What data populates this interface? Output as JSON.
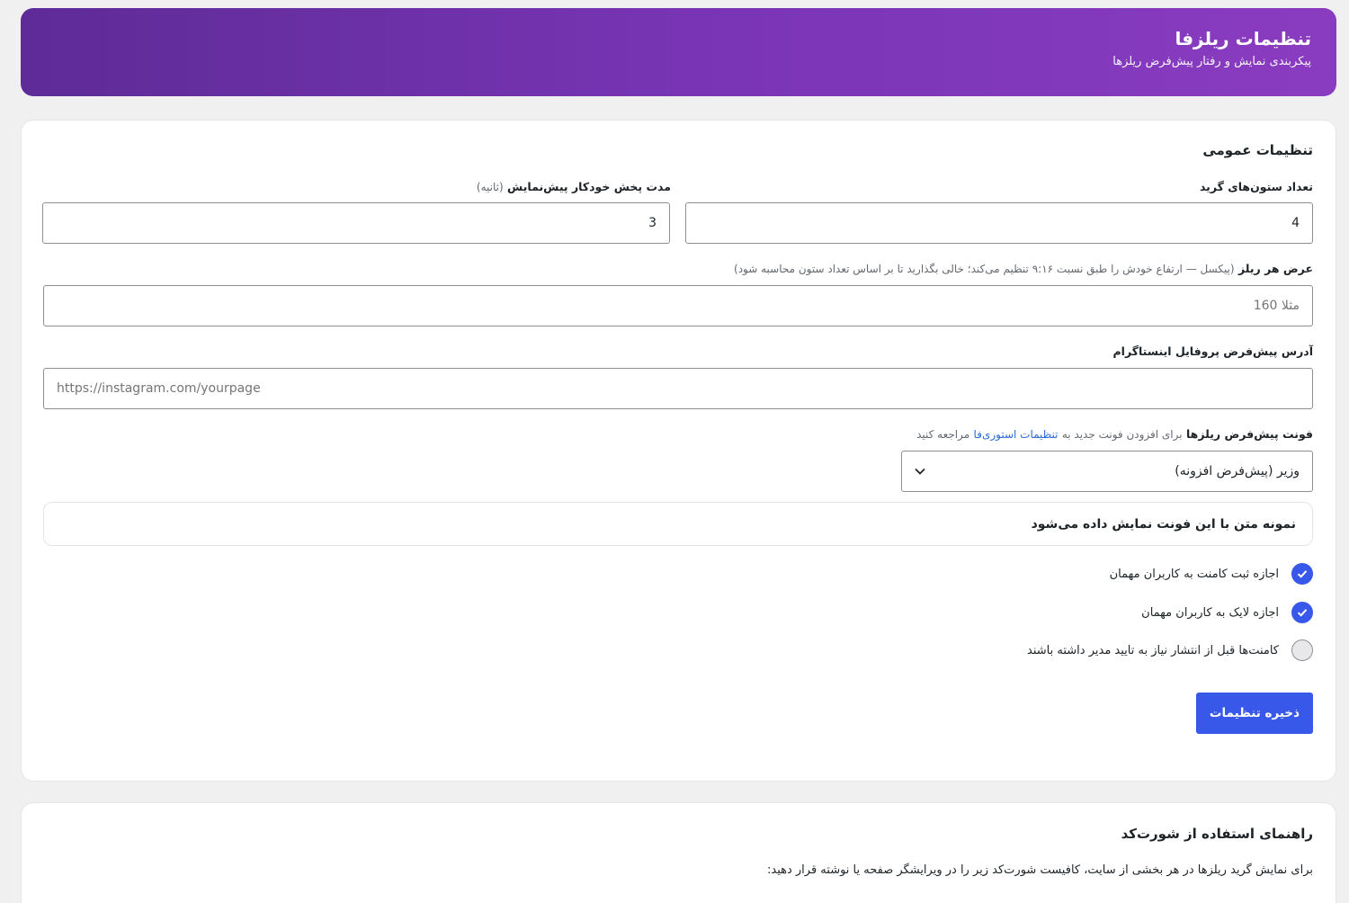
{
  "header": {
    "title": "تنظیمات ریلزفا",
    "subtitle": "پیکربندی نمایش و رفتار پیش‌فرض ریلزها"
  },
  "general": {
    "section_title": "تنظیمات عمومی",
    "grid_columns": {
      "label": "تعداد ستون‌های گرید",
      "value": "4"
    },
    "autoplay": {
      "label": "مدت پخش خودکار پیش‌نمایش",
      "hint": "(ثانیه)",
      "value": "3"
    },
    "reel_width": {
      "label": "عرض هر ریلز",
      "hint": "(پیکسل — ارتفاع خودش را طبق نسبت ۹:۱۶ تنظیم می‌کند؛ خالی بگذارید تا بر اساس تعداد ستون محاسبه شود)",
      "placeholder": "مثلا 160"
    },
    "instagram": {
      "label": "آدرس پیش‌فرض پروفایل اینستاگرام",
      "placeholder": "https://instagram.com/yourpage"
    },
    "font": {
      "label": "فونت پیش‌فرض ریلزها",
      "hint_before": "برای افزودن فونت جدید به",
      "hint_link": "تنظیمات استوری‌فا",
      "hint_after": "مراجعه کنید",
      "selected": "وزیر (پیش‌فرض افزونه)",
      "preview": "نمونه متن با این فونت نمایش داده می‌شود"
    },
    "options": [
      {
        "label": "اجازه ثبت کامنت به کاربران مهمان",
        "checked": true
      },
      {
        "label": "اجازه لایک به کاربران مهمان",
        "checked": true
      },
      {
        "label": "کامنت‌ها قبل از انتشار نیاز به تایید مدیر داشته باشند",
        "checked": false
      }
    ],
    "save_label": "ذخیره تنظیمات"
  },
  "guide": {
    "section_title": "راهنمای استفاده از شورت‌کد",
    "text": "برای نمایش گرید ریلزها در هر بخشی از سایت، کافیست شورت‌کد زیر را در ویرایشگر صفحه یا نوشته قرار دهید:"
  },
  "colors": {
    "accent": "#3858e9",
    "header_start": "#5e2b97",
    "header_end": "#8a3cc0",
    "link": "#2c6ad6"
  }
}
